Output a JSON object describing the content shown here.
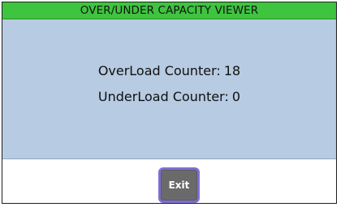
{
  "window": {
    "title": "OVER/UNDER CAPACITY VIEWER"
  },
  "counters": {
    "overload_label": "OverLoad Counter:",
    "overload_value": "18",
    "underload_label": "UnderLoad Counter:",
    "underload_value": "0"
  },
  "actions": {
    "exit_label": "Exit"
  },
  "colors": {
    "title_bar": "#3ec43f",
    "content_panel": "#b7cbe2",
    "exit_button_bg": "#6a6a6a",
    "exit_button_border": "#7d6fd3"
  }
}
